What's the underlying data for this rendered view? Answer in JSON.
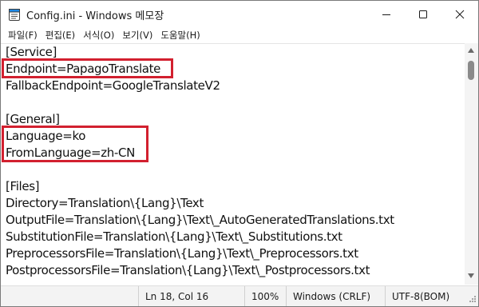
{
  "window": {
    "title": "Config.ini - Windows 메모장",
    "controls": {
      "minimize": "minimize",
      "maximize": "maximize",
      "close": "close"
    }
  },
  "menu": {
    "items": [
      "파일(F)",
      "편집(E)",
      "서식(O)",
      "보기(V)",
      "도움말(H)"
    ]
  },
  "editor": {
    "lines": [
      "[Service]",
      "Endpoint=PapagoTranslate",
      "FallbackEndpoint=GoogleTranslateV2",
      "",
      "[General]",
      "Language=ko",
      "FromLanguage=zh-CN",
      "",
      "[Files]",
      "Directory=Translation\\{Lang}\\Text",
      "OutputFile=Translation\\{Lang}\\Text\\_AutoGeneratedTranslations.txt",
      "SubstitutionFile=Translation\\{Lang}\\Text\\_Substitutions.txt",
      "PreprocessorsFile=Translation\\{Lang}\\Text\\_Preprocessors.txt",
      "PostprocessorsFile=Translation\\{Lang}\\Text\\_Postprocessors.txt"
    ],
    "highlight_color": "#d2202f"
  },
  "status": {
    "position": "Ln 18, Col 16",
    "zoom": "100%",
    "line_ending": "Windows (CRLF)",
    "encoding": "UTF-8(BOM)"
  }
}
